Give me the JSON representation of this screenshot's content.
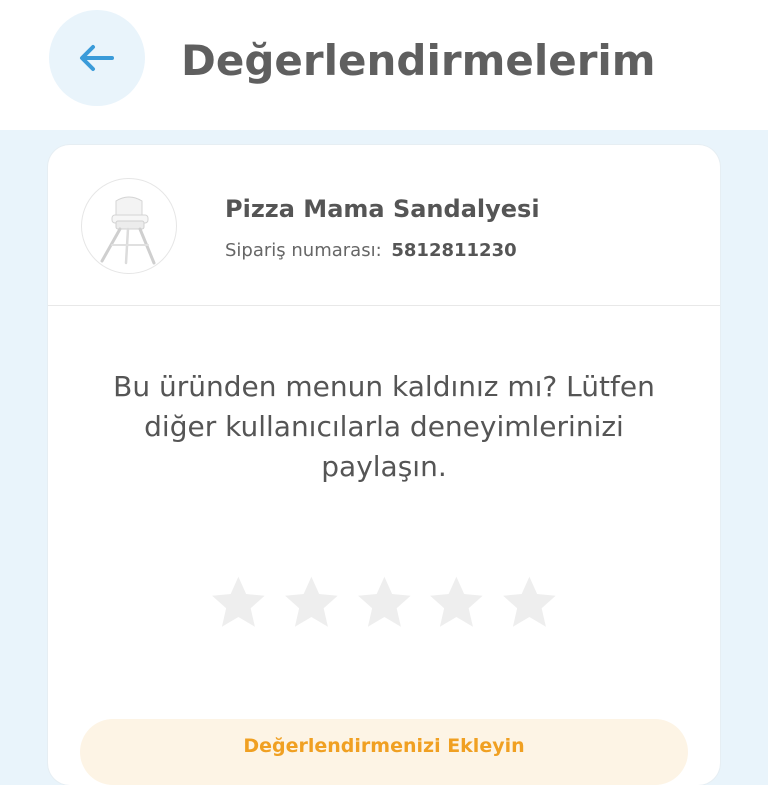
{
  "header": {
    "title": "Değerlendirmelerim",
    "back_icon": "arrow-left-icon"
  },
  "product": {
    "name": "Pizza Mama Sandalyesi",
    "order_label": "Sipariş numarası:",
    "order_number": "5812811230",
    "image_icon": "high-chair-thumbnail"
  },
  "review": {
    "prompt": "Bu üründen menun kaldınız mı? Lütfen diğer kullanıcılarla deneyimlerinizi paylaşın.",
    "rating": 0,
    "max_rating": 5,
    "submit_label": "Değerlendirmenizi Ekleyin"
  },
  "colors": {
    "accent_blue": "#3a9bd9",
    "accent_orange": "#f0a022",
    "star_empty": "#eeeeee"
  }
}
